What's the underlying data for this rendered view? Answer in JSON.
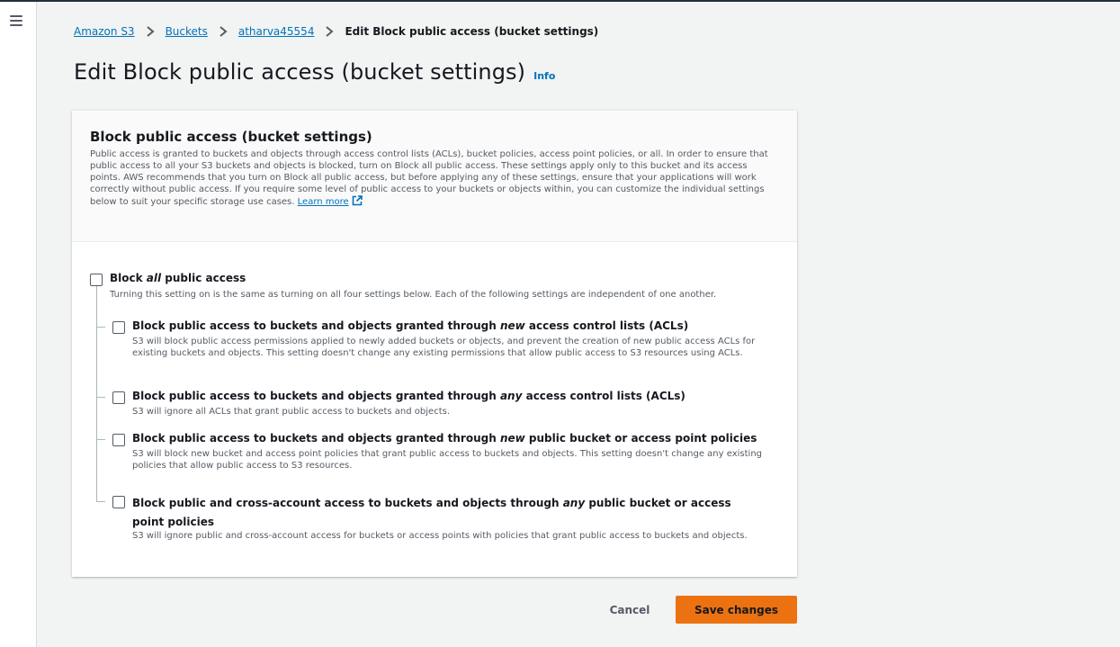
{
  "breadcrumb": {
    "items": [
      "Amazon S3",
      "Buckets",
      "atharva45554"
    ],
    "current": "Edit Block public access (bucket settings)"
  },
  "page": {
    "title": "Edit Block public access (bucket settings)",
    "info": "Info"
  },
  "panel": {
    "title": "Block public access (bucket settings)",
    "description": "Public access is granted to buckets and objects through access control lists (ACLs), bucket policies, access point policies, or all. In order to ensure that public access to all your S3 buckets and objects is blocked, turn on Block all public access. These settings apply only to this bucket and its access points. AWS recommends that you turn on Block all public access, but before applying any of these settings, ensure that your applications will work correctly without public access. If you require some level of public access to your buckets or objects within, you can customize the individual settings below to suit your specific storage use cases.",
    "learn_more": "Learn more"
  },
  "block_all": {
    "label_prefix": "Block ",
    "label_em": "all",
    "label_suffix": " public access",
    "description": "Turning this setting on is the same as turning on all four settings below. Each of the following settings are independent of one another.",
    "checked": false
  },
  "options": [
    {
      "label_prefix": "Block public access to buckets and objects granted through ",
      "label_em": "new",
      "label_suffix": " access control lists (ACLs)",
      "description": "S3 will block public access permissions applied to newly added buckets or objects, and prevent the creation of new public access ACLs for existing buckets and objects. This setting doesn't change any existing permissions that allow public access to S3 resources using ACLs.",
      "checked": false
    },
    {
      "label_prefix": "Block public access to buckets and objects granted through ",
      "label_em": "any",
      "label_suffix": " access control lists (ACLs)",
      "description": "S3 will ignore all ACLs that grant public access to buckets and objects.",
      "checked": false
    },
    {
      "label_prefix": "Block public access to buckets and objects granted through ",
      "label_em": "new",
      "label_suffix": " public bucket or access point policies",
      "description": "S3 will block new bucket and access point policies that grant public access to buckets and objects. This setting doesn't change any existing policies that allow public access to S3 resources.",
      "checked": false
    },
    {
      "label_prefix": "Block public and cross-account access to buckets and objects through ",
      "label_em": "any",
      "label_suffix": " public bucket or access point policies",
      "description": "S3 will ignore public and cross-account access for buckets or access points with policies that grant public access to buckets and objects.",
      "checked": false
    }
  ],
  "actions": {
    "cancel": "Cancel",
    "save": "Save changes"
  },
  "colors": {
    "link": "#0073bb",
    "primary_button": "#ec7211",
    "page_background": "#f2f3f3"
  }
}
